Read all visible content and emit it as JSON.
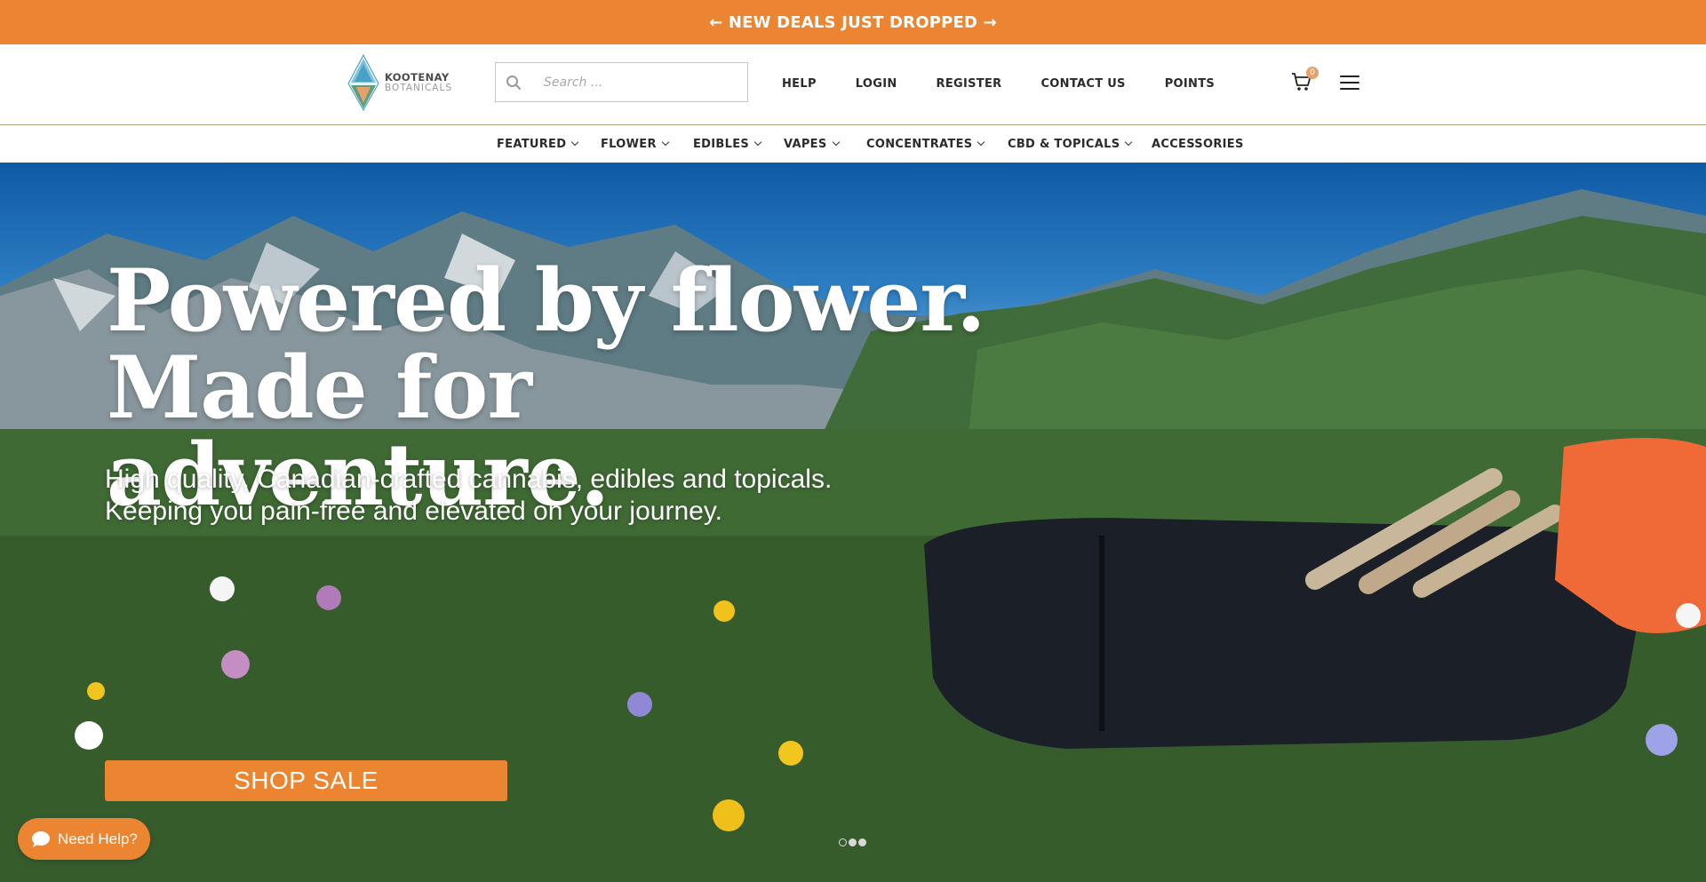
{
  "announcement": {
    "text": "← NEW DEALS JUST DROPPED →"
  },
  "header": {
    "logo": {
      "line1": "KOOTENAY",
      "line2": "BOTANICALS"
    },
    "search": {
      "placeholder": "Search ...",
      "icon": "search-icon"
    },
    "links": [
      {
        "label": "HELP"
      },
      {
        "label": "LOGIN"
      },
      {
        "label": "REGISTER"
      },
      {
        "label": "CONTACT US"
      },
      {
        "label": "POINTS"
      }
    ],
    "cart": {
      "count": "0",
      "icon": "cart-icon"
    },
    "menu_icon": "hamburger-menu-icon"
  },
  "categories": [
    {
      "label": "FEATURED",
      "dropdown": true
    },
    {
      "label": "FLOWER",
      "dropdown": true
    },
    {
      "label": "EDIBLES",
      "dropdown": true
    },
    {
      "label": "VAPES",
      "dropdown": true
    },
    {
      "label": "CONCENTRATES",
      "dropdown": true
    },
    {
      "label": "CBD & TOPICALS",
      "dropdown": true
    },
    {
      "label": "ACCESSORIES",
      "dropdown": false
    }
  ],
  "hero": {
    "title_line1": "Powered by flower.",
    "title_line2": "Made for adventure.",
    "subtitle_line1": "High quality, Canadian-crafted cannabis, edibles and topicals.",
    "subtitle_line2": "Keeping you pain-free and elevated on your journey.",
    "cta": "SHOP SALE",
    "slides": 3,
    "active_slide": 2
  },
  "help_widget": {
    "label": "Need Help?"
  },
  "colors": {
    "accent": "#ec8531",
    "text": "#2b2b2b"
  }
}
